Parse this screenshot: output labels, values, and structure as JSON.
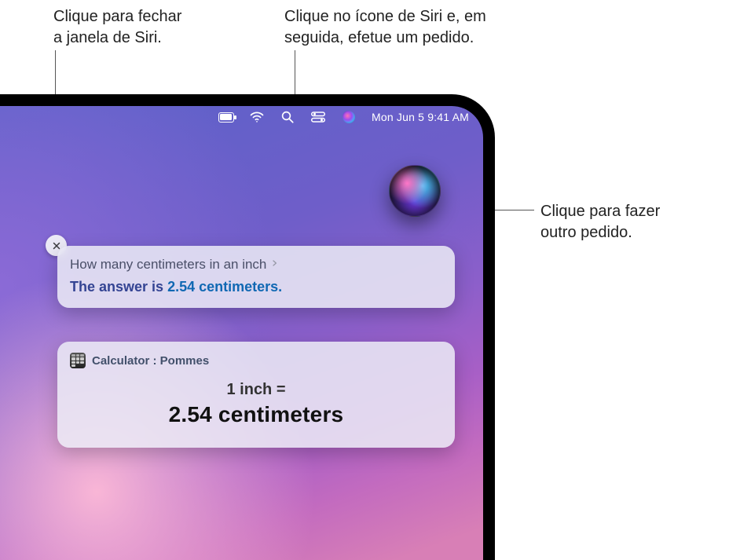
{
  "callouts": {
    "close": "Clique para fechar\na janela de Siri.",
    "menuSiri": "Clique no ícone de Siri e, em\nseguida, efetue um pedido.",
    "orb": "Clique para fazer\noutro pedido."
  },
  "menubar": {
    "datetime": "Mon Jun 5  9:41 AM"
  },
  "siri": {
    "query": "How many centimeters in an inch",
    "answer_lead": "The answer is ",
    "answer_value": "2.54",
    "answer_unit": " centimeters."
  },
  "calculator": {
    "header": "Calculator : Pommes",
    "question": "1 inch =",
    "answer": "2.54 centimeters"
  }
}
